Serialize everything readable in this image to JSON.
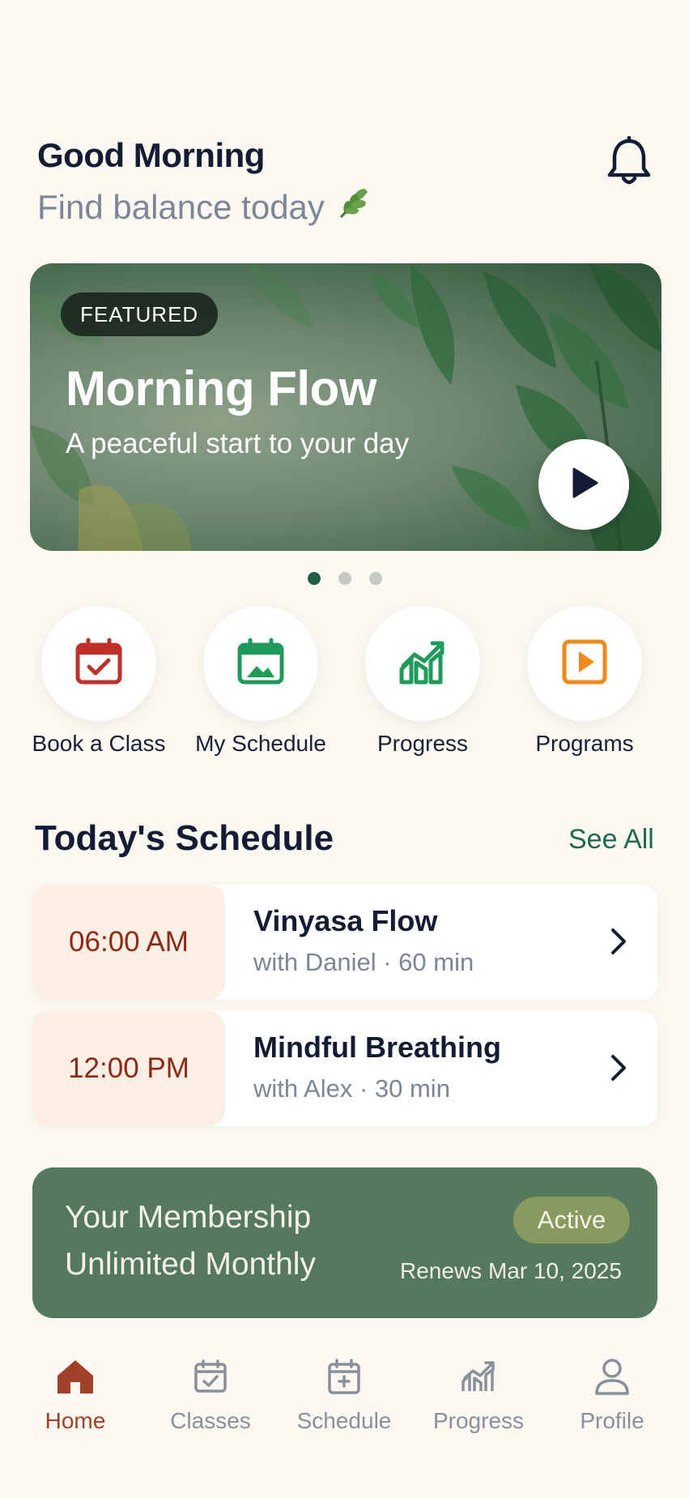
{
  "header": {
    "greeting": "Good Morning",
    "subtitle": "Find balance today",
    "subtitle_icon": "leaf-icon",
    "notification_icon": "bell-icon"
  },
  "featured": {
    "badge": "FEATURED",
    "title": "Morning Flow",
    "subtitle": "A peaceful start to your day",
    "play_icon": "play-icon",
    "carousel_pages": 3,
    "carousel_active_index": 0
  },
  "quick_actions": [
    {
      "label": "Book a Class",
      "icon": "calendar-check-icon",
      "color": "#c0302b"
    },
    {
      "label": "My Schedule",
      "icon": "calendar-icon",
      "color": "#1e9a5a"
    },
    {
      "label": "Progress",
      "icon": "chart-up-icon",
      "color": "#1e9a5a"
    },
    {
      "label": "Programs",
      "icon": "video-icon",
      "color": "#f08a1c"
    }
  ],
  "schedule": {
    "title": "Today's Schedule",
    "see_all": "See All",
    "items": [
      {
        "time": "06:00 AM",
        "name": "Vinyasa Flow",
        "meta": "with Daniel · 60 min"
      },
      {
        "time": "12:00 PM",
        "name": "Mindful Breathing",
        "meta": "with Alex · 30 min"
      }
    ]
  },
  "membership": {
    "line1": "Your Membership",
    "line2": "Unlimited Monthly",
    "status": "Active",
    "renews": "Renews Mar 10, 2025"
  },
  "bottom_nav": {
    "active_index": 0,
    "items": [
      {
        "label": "Home",
        "icon": "home-icon"
      },
      {
        "label": "Classes",
        "icon": "calendar-check-icon"
      },
      {
        "label": "Schedule",
        "icon": "calendar-icon"
      },
      {
        "label": "Progress",
        "icon": "chart-up-icon"
      },
      {
        "label": "Profile",
        "icon": "user-icon"
      }
    ]
  },
  "colors": {
    "background": "#fbf8f2",
    "primary_green": "#1f6a4b",
    "accent_red": "#a3402a",
    "membership_bg": "#54795d"
  }
}
